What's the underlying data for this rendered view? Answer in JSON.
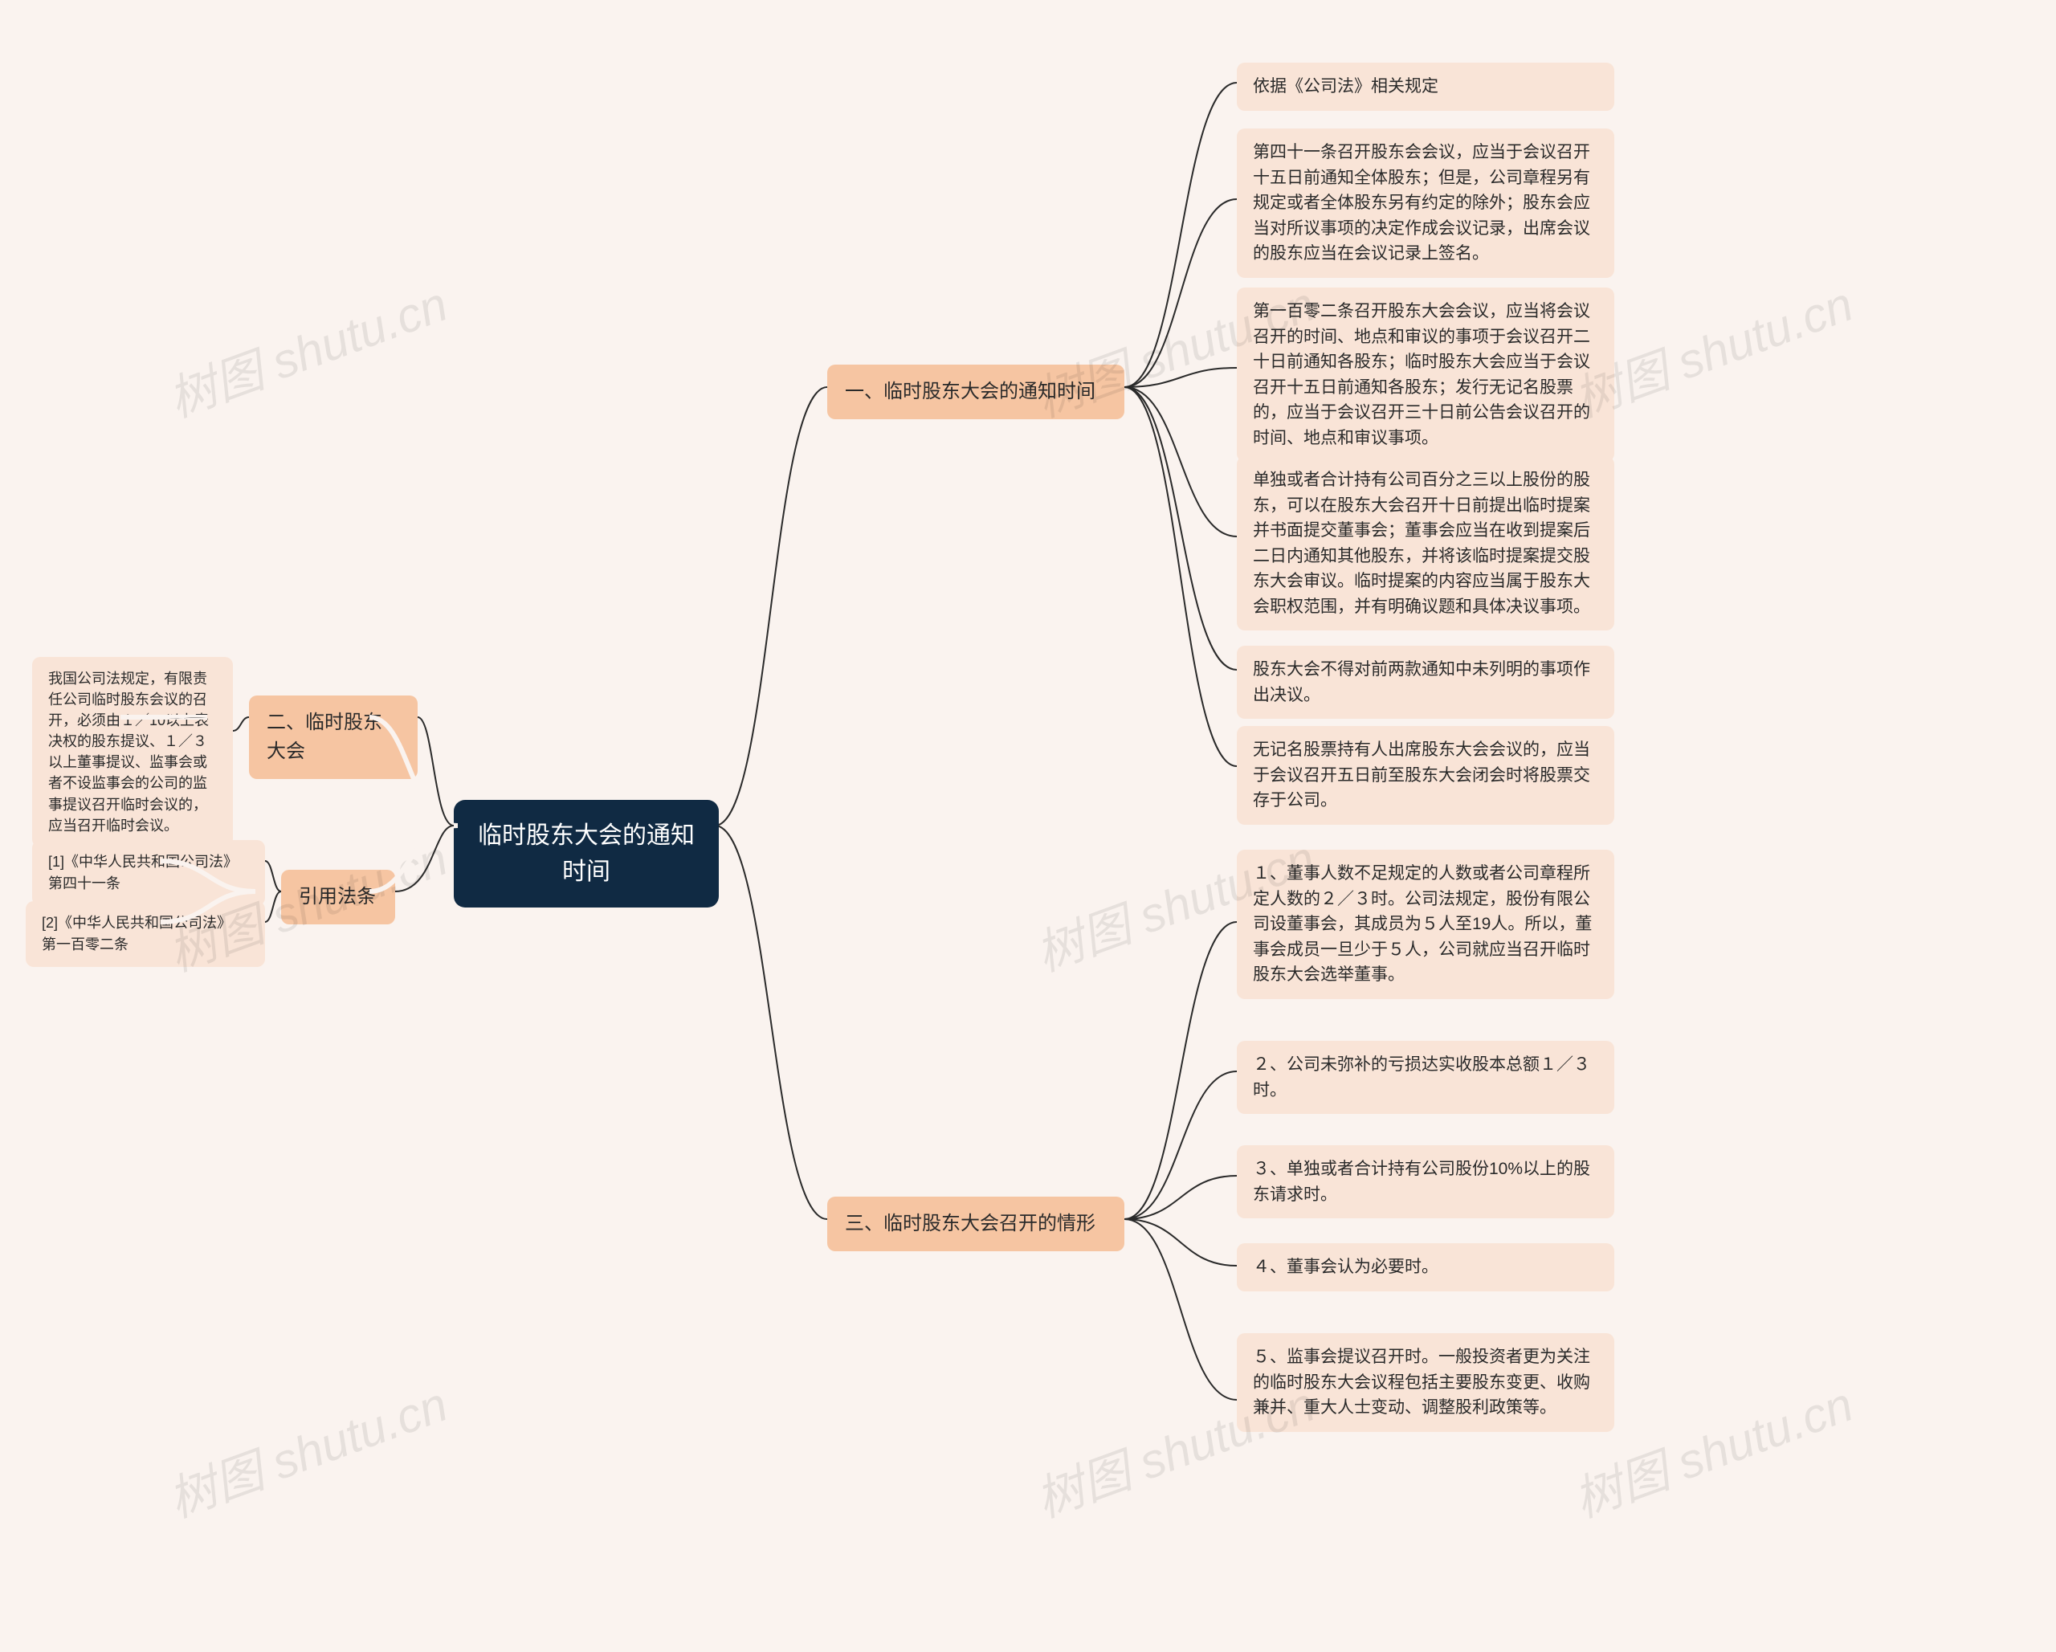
{
  "root": {
    "title": "临时股东大会的通知时间"
  },
  "branches": {
    "b1": {
      "label": "一、临时股东大会的通知时间"
    },
    "b2": {
      "label": "二、临时股东大会"
    },
    "b3": {
      "label": "三、临时股东大会召开的情形"
    },
    "b4": {
      "label": "引用法条"
    }
  },
  "leaves": {
    "b1_1": "依据《公司法》相关规定",
    "b1_2": "第四十一条召开股东会会议，应当于会议召开十五日前通知全体股东；但是，公司章程另有规定或者全体股东另有约定的除外；股东会应当对所议事项的决定作成会议记录，出席会议的股东应当在会议记录上签名。",
    "b1_3": "第一百零二条召开股东大会会议，应当将会议召开的时间、地点和审议的事项于会议召开二十日前通知各股东；临时股东大会应当于会议召开十五日前通知各股东；发行无记名股票的，应当于会议召开三十日前公告会议召开的时间、地点和审议事项。",
    "b1_4": "单独或者合计持有公司百分之三以上股份的股东，可以在股东大会召开十日前提出临时提案并书面提交董事会；董事会应当在收到提案后二日内通知其他股东，并将该临时提案提交股东大会审议。临时提案的内容应当属于股东大会职权范围，并有明确议题和具体决议事项。",
    "b1_5": "股东大会不得对前两款通知中未列明的事项作出决议。",
    "b1_6": "无记名股票持有人出席股东大会会议的，应当于会议召开五日前至股东大会闭会时将股票交存于公司。",
    "b2_1": "我国公司法规定，有限责任公司临时股东会议的召开，必须由１／10以上表决权的股东提议、１／３以上董事提议、监事会或者不设监事会的公司的监事提议召开临时会议的，应当召开临时会议。",
    "b3_1": "１、董事人数不足规定的人数或者公司章程所定人数的２／３时。公司法规定，股份有限公司设董事会，其成员为５人至19人。所以，董事会成员一旦少于５人，公司就应当召开临时股东大会选举董事。",
    "b3_2": "２、公司未弥补的亏损达实收股本总额１／３时。",
    "b3_3": "３、单独或者合计持有公司股份10%以上的股东请求时。",
    "b3_4": "４、董事会认为必要时。",
    "b3_5": "５、监事会提议召开时。一般投资者更为关注的临时股东大会议程包括主要股东变更、收购兼并、重大人士变动、调整股利政策等。",
    "b4_1": "[1]《中华人民共和国公司法》 第四十一条",
    "b4_2": "[2]《中华人民共和国公司法》 第一百零二条"
  },
  "watermark": "树图 shutu.cn",
  "connector_color": "#2a2a2a"
}
